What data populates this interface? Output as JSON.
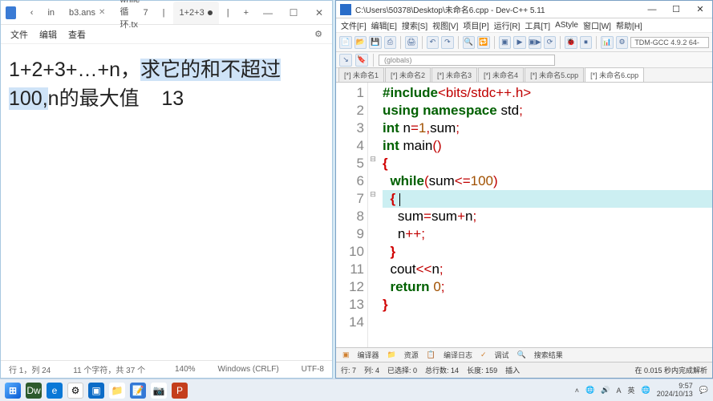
{
  "left": {
    "tabs": {
      "nav_back": "‹",
      "t1": "in",
      "t2": "b3.ans",
      "t3": "while循环.tx",
      "t3_count": "7",
      "active": "1+2+3",
      "active_dot": "●",
      "add": "+"
    },
    "winbtns": {
      "min": "—",
      "max": "☐",
      "close": "✕"
    },
    "menu": {
      "file": "文件",
      "edit": "编辑",
      "view": "查看",
      "gear": "⚙"
    },
    "content": {
      "line1a": "1+2+3+…+n，",
      "line1b": "求它的和不超过",
      "line2a": "100,",
      "line2b": "n的最大值",
      "line2c": "13"
    },
    "status": {
      "pos": "行 1，列 24",
      "chars": "11 个字符，共 37 个",
      "zoom": "140%",
      "encoding": "Windows (CRLF)",
      "enc2": "UTF-8"
    }
  },
  "right": {
    "title": "C:\\Users\\50378\\Desktop\\未命名6.cpp - Dev-C++ 5.11",
    "winbtns": {
      "min": "—",
      "max": "☐",
      "close": "✕"
    },
    "menu": {
      "m1": "文件[F]",
      "m2": "编辑[E]",
      "m3": "搜索[S]",
      "m4": "视图[V]",
      "m5": "项目[P]",
      "m6": "运行[R]",
      "m7": "工具[T]",
      "m8": "AStyle",
      "m9": "窗口[W]",
      "m10": "帮助[H]"
    },
    "compiler_selector": "TDM-GCC 4.9.2 64-",
    "globals_selector": "(globals)",
    "tabs": {
      "t1": "[*] 未命名1",
      "t2": "[*] 未命名2",
      "t3": "[*] 未命名3",
      "t4": "[*] 未命名4",
      "t5": "[*] 未命名5.cpp",
      "t6": "[*] 未命名6.cpp"
    },
    "code": {
      "l1a": "#include",
      "l1b": "<bits/stdc++.h>",
      "l2a": "using",
      "l2b": "namespace",
      "l2c": "std",
      "l3a": "int",
      "l3b": "n",
      "l3c": "1",
      "l3d": "sum",
      "l4a": "int",
      "l4b": "main",
      "l5": "{",
      "l6a": "while",
      "l6b": "sum",
      "l6c": "100",
      "l7": "{",
      "l8a": "sum",
      "l8b": "sum",
      "l8c": "n",
      "l9": "n",
      "l10": "}",
      "l11a": "cout",
      "l11b": "n",
      "l12a": "return",
      "l12b": "0",
      "l13": "}"
    },
    "gutter": {
      "g1": "1",
      "g2": "2",
      "g3": "3",
      "g4": "4",
      "g5": "5",
      "g6": "6",
      "g7": "7",
      "g8": "8",
      "g9": "9",
      "g10": "10",
      "g11": "11",
      "g12": "12",
      "g13": "13",
      "g14": "14"
    },
    "fold": {
      "f5": "⊟",
      "f7": "⊟"
    },
    "bottom_tabs": {
      "b1": "编译器",
      "b2": "资源",
      "b3": "编译日志",
      "b4": "调试",
      "b5": "搜索结果"
    },
    "status": {
      "line": "行:    7",
      "col": "列:    4",
      "sel": "已选择:    0",
      "total": "总行数:    14",
      "len": "长度:    159",
      "ins": "插入",
      "done": "在 0.015 秒内完成解析"
    }
  },
  "taskbar": {
    "start": "⊞",
    "tray": {
      "up": "˄",
      "net": "🌐",
      "vol": "🔊",
      "lang1": "A",
      "lang2": "英",
      "lang3": "🌐",
      "time": "9:57",
      "date": "2024/10/13",
      "notif": "💬"
    }
  }
}
